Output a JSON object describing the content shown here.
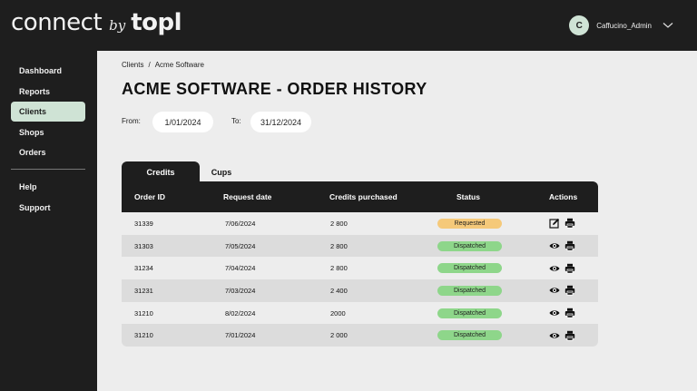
{
  "brand": {
    "connect": "connect",
    "by": "by",
    "topl": "topl"
  },
  "user": {
    "initial": "C",
    "name": "Caffucino_Admin"
  },
  "sidebar": {
    "items": [
      {
        "label": "Dashboard"
      },
      {
        "label": "Reports"
      },
      {
        "label": "Clients",
        "active": true
      },
      {
        "label": "Shops"
      },
      {
        "label": "Orders"
      },
      {
        "label": "Help"
      },
      {
        "label": "Support"
      }
    ]
  },
  "breadcrumb": {
    "parent": "Clients",
    "separator": "/",
    "current": "Acme Software"
  },
  "page": {
    "title": "ACME SOFTWARE - ORDER HISTORY"
  },
  "filters": {
    "from_label": "From:",
    "from_value": "1/01/2024",
    "to_label": "To:",
    "to_value": "31/12/2024"
  },
  "tabs": [
    {
      "label": "Credits",
      "active": true
    },
    {
      "label": "Cups"
    }
  ],
  "table": {
    "headers": [
      "Order ID",
      "Request date",
      "Credits purchased",
      "Status",
      "Actions"
    ],
    "rows": [
      {
        "order_id": "31339",
        "date": "7/06/2024",
        "credits": "2 800",
        "status": "Requested",
        "action_icon": "edit-icon"
      },
      {
        "order_id": "31303",
        "date": "7/05/2024",
        "credits": "2 800",
        "status": "Dispatched",
        "action_icon": "eye-icon"
      },
      {
        "order_id": "31234",
        "date": "7/04/2024",
        "credits": "2 800",
        "status": "Dispatched",
        "action_icon": "eye-icon"
      },
      {
        "order_id": "31231",
        "date": "7/03/2024",
        "credits": "2 400",
        "status": "Dispatched",
        "action_icon": "eye-icon"
      },
      {
        "order_id": "31210",
        "date": "8/02/2024",
        "credits": "2000",
        "status": "Dispatched",
        "action_icon": "eye-icon"
      },
      {
        "order_id": "31210",
        "date": "7/01/2024",
        "credits": "2 000",
        "status": "Dispatched",
        "action_icon": "eye-icon"
      }
    ]
  },
  "colors": {
    "dark": "#1e1e1e",
    "accent": "#cfe3d5",
    "requested": "#f5c97a",
    "dispatched": "#8ed68a"
  }
}
